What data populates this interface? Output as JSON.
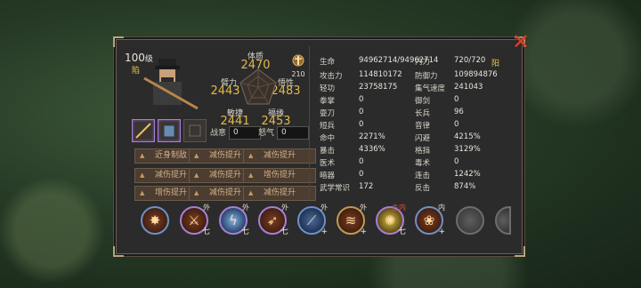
{
  "character": {
    "level": "100",
    "level_suffix": "级",
    "tag": "陷",
    "rank": "210",
    "yang": "阳"
  },
  "stats": {
    "constitution": {
      "label": "体质",
      "value": "2470"
    },
    "arm_strength": {
      "label": "臂力",
      "value": "2443"
    },
    "insight": {
      "label": "悟性",
      "value": "2483"
    },
    "agility": {
      "label": "敏捷",
      "value": "2441"
    },
    "fortune": {
      "label": "福缘",
      "value": "2453"
    }
  },
  "meters": {
    "battle_will": {
      "label": "战意",
      "value": "0"
    },
    "rage": {
      "label": "怒气",
      "value": "0"
    }
  },
  "buffs": [
    "近身制敌",
    "减伤提升",
    "减伤提升",
    "减伤提升",
    "减伤提升",
    "增伤提升",
    "增伤提升",
    "减伤提升",
    "减伤提升"
  ],
  "attributes": {
    "left": [
      {
        "label": "生命",
        "value": "94962714/94962714"
      },
      {
        "label": "攻击力",
        "value": "114810172"
      },
      {
        "label": "轻功",
        "value": "23758175"
      },
      {
        "label": "拳掌",
        "value": "0"
      },
      {
        "label": "耍刀",
        "value": "0"
      },
      {
        "label": "短兵",
        "value": "0"
      },
      {
        "label": "命中",
        "value": "2271%"
      },
      {
        "label": "暴击",
        "value": "4336%"
      },
      {
        "label": "医术",
        "value": "0"
      },
      {
        "label": "暗器",
        "value": "0"
      },
      {
        "label": "武学常识",
        "value": "172"
      }
    ],
    "right": [
      {
        "label": "内力",
        "value": "720/720"
      },
      {
        "label": "防御力",
        "value": "109894876"
      },
      {
        "label": "集气速度",
        "value": "241043"
      },
      {
        "label": "御剑",
        "value": "0"
      },
      {
        "label": "长兵",
        "value": "96"
      },
      {
        "label": "音律",
        "value": "0"
      },
      {
        "label": "闪避",
        "value": "4215%"
      },
      {
        "label": "格挡",
        "value": "3129%"
      },
      {
        "label": "毒术",
        "value": "0"
      },
      {
        "label": "连击",
        "value": "1242%"
      },
      {
        "label": "反击",
        "value": "874%"
      }
    ]
  },
  "skills": [
    {
      "type": "外",
      "level": "七"
    },
    {
      "type": "外",
      "level": "七"
    },
    {
      "type": "外",
      "level": "七"
    },
    {
      "type": "外",
      "level": "+"
    },
    {
      "type": "外",
      "level": "+"
    },
    {
      "type": "主内",
      "level": "七"
    },
    {
      "type": "内",
      "level": "+"
    }
  ],
  "colors": {
    "panel_bg": "#2b2b2c",
    "stat_value": "#e2b948",
    "close": "#d8402c"
  }
}
